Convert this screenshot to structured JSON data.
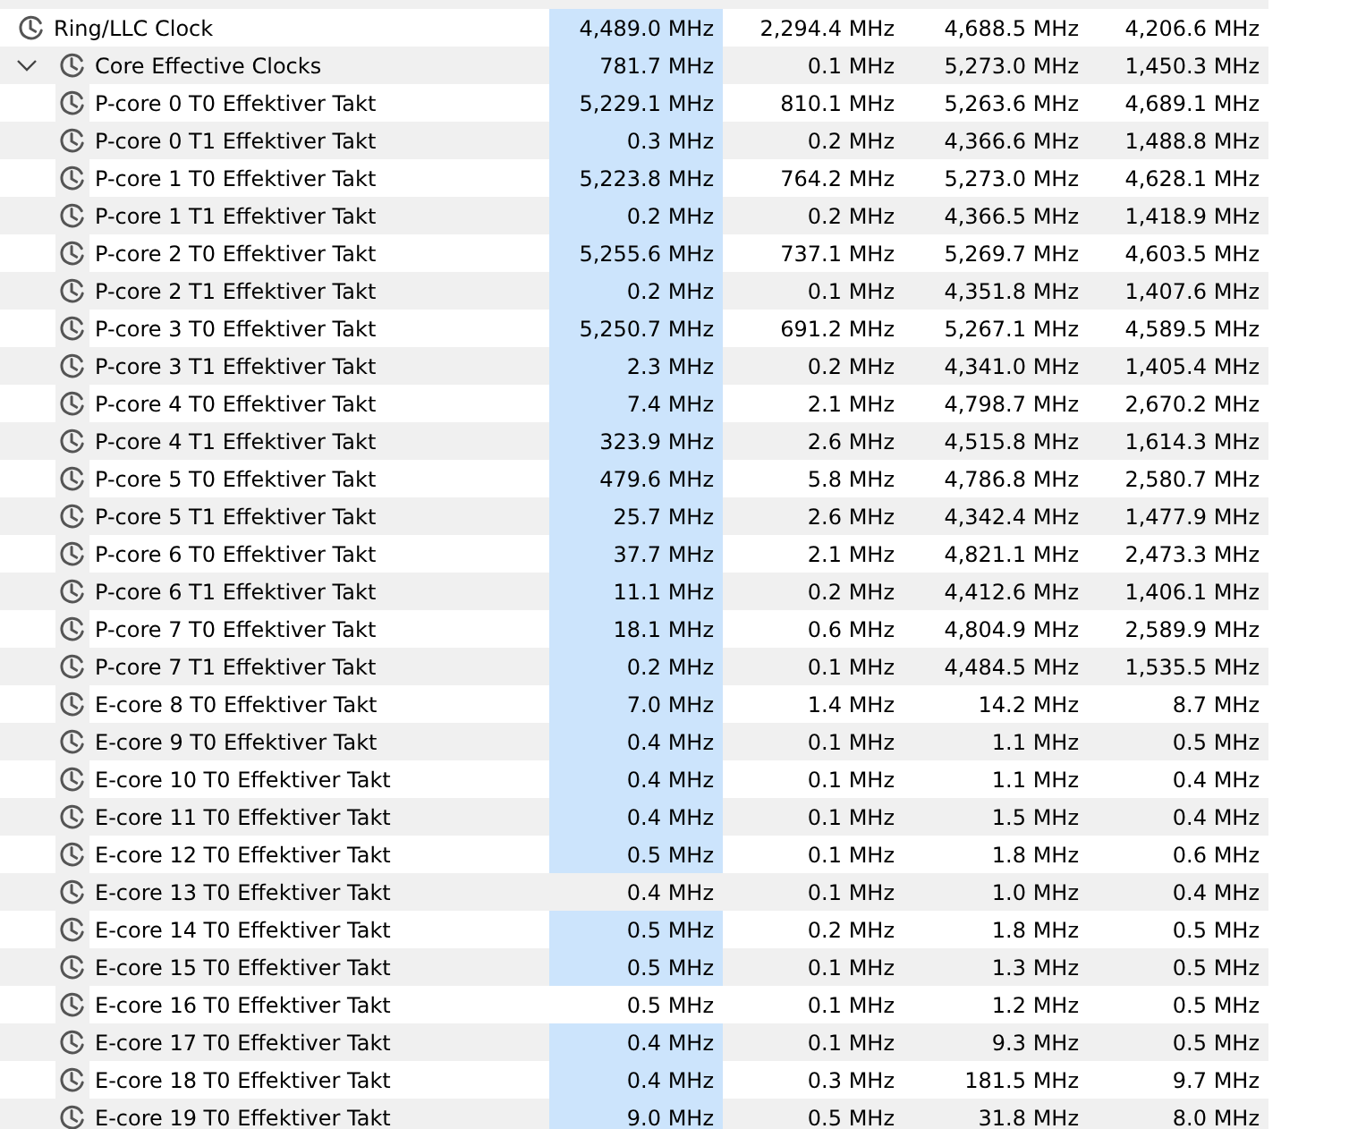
{
  "rows": [
    {
      "label": "Ring/LLC Clock",
      "values": [
        "4,489.0 MHz",
        "2,294.4 MHz",
        "4,688.5 MHz",
        "4,206.6 MHz"
      ],
      "highlighted": true
    },
    {
      "label": "Core Effective Clocks",
      "values": [
        "781.7 MHz",
        "0.1 MHz",
        "5,273.0 MHz",
        "1,450.3 MHz"
      ],
      "highlighted": true,
      "expanded": true,
      "children": [
        {
          "label": "P-core 0 T0 Effektiver Takt",
          "values": [
            "5,229.1 MHz",
            "810.1 MHz",
            "5,263.6 MHz",
            "4,689.1 MHz"
          ],
          "highlighted": true
        },
        {
          "label": "P-core 0 T1 Effektiver Takt",
          "values": [
            "0.3 MHz",
            "0.2 MHz",
            "4,366.6 MHz",
            "1,488.8 MHz"
          ],
          "highlighted": true
        },
        {
          "label": "P-core 1 T0 Effektiver Takt",
          "values": [
            "5,223.8 MHz",
            "764.2 MHz",
            "5,273.0 MHz",
            "4,628.1 MHz"
          ],
          "highlighted": true
        },
        {
          "label": "P-core 1 T1 Effektiver Takt",
          "values": [
            "0.2 MHz",
            "0.2 MHz",
            "4,366.5 MHz",
            "1,418.9 MHz"
          ],
          "highlighted": true
        },
        {
          "label": "P-core 2 T0 Effektiver Takt",
          "values": [
            "5,255.6 MHz",
            "737.1 MHz",
            "5,269.7 MHz",
            "4,603.5 MHz"
          ],
          "highlighted": true
        },
        {
          "label": "P-core 2 T1 Effektiver Takt",
          "values": [
            "0.2 MHz",
            "0.1 MHz",
            "4,351.8 MHz",
            "1,407.6 MHz"
          ],
          "highlighted": true
        },
        {
          "label": "P-core 3 T0 Effektiver Takt",
          "values": [
            "5,250.7 MHz",
            "691.2 MHz",
            "5,267.1 MHz",
            "4,589.5 MHz"
          ],
          "highlighted": true
        },
        {
          "label": "P-core 3 T1 Effektiver Takt",
          "values": [
            "2.3 MHz",
            "0.2 MHz",
            "4,341.0 MHz",
            "1,405.4 MHz"
          ],
          "highlighted": true
        },
        {
          "label": "P-core 4 T0 Effektiver Takt",
          "values": [
            "7.4 MHz",
            "2.1 MHz",
            "4,798.7 MHz",
            "2,670.2 MHz"
          ],
          "highlighted": true
        },
        {
          "label": "P-core 4 T1 Effektiver Takt",
          "values": [
            "323.9 MHz",
            "2.6 MHz",
            "4,515.8 MHz",
            "1,614.3 MHz"
          ],
          "highlighted": true
        },
        {
          "label": "P-core 5 T0 Effektiver Takt",
          "values": [
            "479.6 MHz",
            "5.8 MHz",
            "4,786.8 MHz",
            "2,580.7 MHz"
          ],
          "highlighted": true
        },
        {
          "label": "P-core 5 T1 Effektiver Takt",
          "values": [
            "25.7 MHz",
            "2.6 MHz",
            "4,342.4 MHz",
            "1,477.9 MHz"
          ],
          "highlighted": true
        },
        {
          "label": "P-core 6 T0 Effektiver Takt",
          "values": [
            "37.7 MHz",
            "2.1 MHz",
            "4,821.1 MHz",
            "2,473.3 MHz"
          ],
          "highlighted": true
        },
        {
          "label": "P-core 6 T1 Effektiver Takt",
          "values": [
            "11.1 MHz",
            "0.2 MHz",
            "4,412.6 MHz",
            "1,406.1 MHz"
          ],
          "highlighted": true
        },
        {
          "label": "P-core 7 T0 Effektiver Takt",
          "values": [
            "18.1 MHz",
            "0.6 MHz",
            "4,804.9 MHz",
            "2,589.9 MHz"
          ],
          "highlighted": true
        },
        {
          "label": "P-core 7 T1 Effektiver Takt",
          "values": [
            "0.2 MHz",
            "0.1 MHz",
            "4,484.5 MHz",
            "1,535.5 MHz"
          ],
          "highlighted": true
        },
        {
          "label": "E-core 8 T0 Effektiver Takt",
          "values": [
            "7.0 MHz",
            "1.4 MHz",
            "14.2 MHz",
            "8.7 MHz"
          ],
          "highlighted": true
        },
        {
          "label": "E-core 9 T0 Effektiver Takt",
          "values": [
            "0.4 MHz",
            "0.1 MHz",
            "1.1 MHz",
            "0.5 MHz"
          ],
          "highlighted": true
        },
        {
          "label": "E-core 10 T0 Effektiver Takt",
          "values": [
            "0.4 MHz",
            "0.1 MHz",
            "1.1 MHz",
            "0.4 MHz"
          ],
          "highlighted": true
        },
        {
          "label": "E-core 11 T0 Effektiver Takt",
          "values": [
            "0.4 MHz",
            "0.1 MHz",
            "1.5 MHz",
            "0.4 MHz"
          ],
          "highlighted": true
        },
        {
          "label": "E-core 12 T0 Effektiver Takt",
          "values": [
            "0.5 MHz",
            "0.1 MHz",
            "1.8 MHz",
            "0.6 MHz"
          ],
          "highlighted": true
        },
        {
          "label": "E-core 13 T0 Effektiver Takt",
          "values": [
            "0.4 MHz",
            "0.1 MHz",
            "1.0 MHz",
            "0.4 MHz"
          ],
          "highlighted": false
        },
        {
          "label": "E-core 14 T0 Effektiver Takt",
          "values": [
            "0.5 MHz",
            "0.2 MHz",
            "1.8 MHz",
            "0.5 MHz"
          ],
          "highlighted": true
        },
        {
          "label": "E-core 15 T0 Effektiver Takt",
          "values": [
            "0.5 MHz",
            "0.1 MHz",
            "1.3 MHz",
            "0.5 MHz"
          ],
          "highlighted": true
        },
        {
          "label": "E-core 16 T0 Effektiver Takt",
          "values": [
            "0.5 MHz",
            "0.1 MHz",
            "1.2 MHz",
            "0.5 MHz"
          ],
          "highlighted": false
        },
        {
          "label": "E-core 17 T0 Effektiver Takt",
          "values": [
            "0.4 MHz",
            "0.1 MHz",
            "9.3 MHz",
            "0.5 MHz"
          ],
          "highlighted": true
        },
        {
          "label": "E-core 18 T0 Effektiver Takt",
          "values": [
            "0.4 MHz",
            "0.3 MHz",
            "181.5 MHz",
            "9.7 MHz"
          ],
          "highlighted": true
        },
        {
          "label": "E-core 19 T0 Effektiver Takt",
          "values": [
            "9.0 MHz",
            "0.5 MHz",
            "31.8 MHz",
            "8.0 MHz"
          ],
          "highlighted": true
        }
      ]
    }
  ]
}
